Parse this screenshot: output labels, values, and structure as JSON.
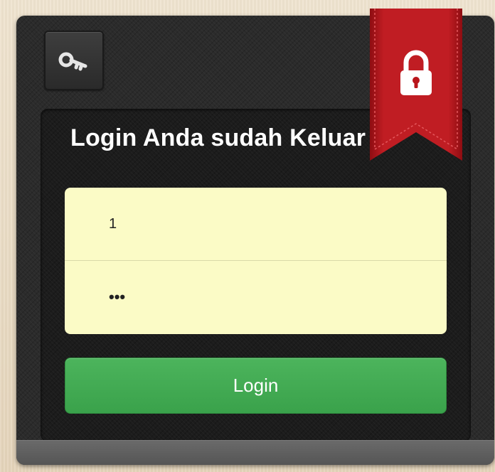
{
  "login_panel": {
    "title": "Login Anda sudah Keluar",
    "username": {
      "value": "1"
    },
    "password": {
      "value": "•••"
    },
    "submit_label": "Login"
  },
  "icons": {
    "key": "key-icon",
    "lock": "lock-icon"
  },
  "colors": {
    "panel_background": "#2b2b2b",
    "input_background": "#fbfbc6",
    "button_green": "#3fa54f",
    "ribbon_red": "#b9151b"
  }
}
